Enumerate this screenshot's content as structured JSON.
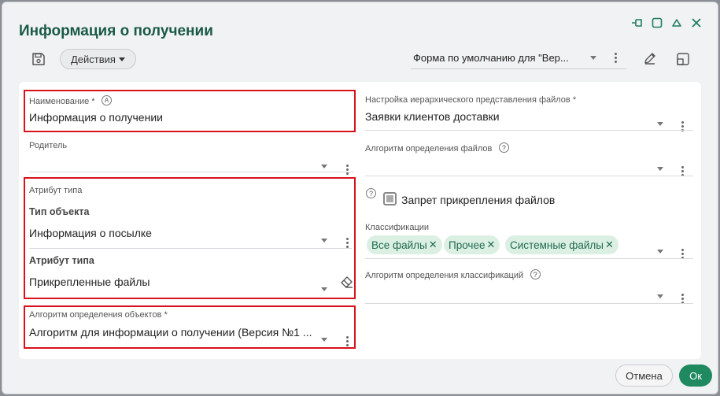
{
  "dialog": {
    "title": "Информация о получении"
  },
  "toolbar": {
    "actions_label": "Действия",
    "form_select": "Форма по умолчанию для \"Вер..."
  },
  "left": {
    "name_label": "Наименование *",
    "name_value": "Информация о получении",
    "parent_label": "Родитель",
    "type_attr_group_label": "Атрибут типа",
    "object_type_label": "Тип объекта",
    "object_type_value": "Информация о посылке",
    "type_attr_label": "Атрибут типа",
    "type_attr_value": "Прикрепленные файлы",
    "algo_objects_label": "Алгоритм определения объектов *",
    "algo_objects_value": "Алгоритм для информации о получении (Версия №1 ..."
  },
  "right": {
    "hierarchy_label": "Настройка иерархического представления файлов *",
    "hierarchy_value": "Заявки клиентов доставки",
    "algo_files_label": "Алгоритм определения файлов",
    "attach_ban_label": "Запрет прикрепления файлов",
    "classifications_label": "Классификации",
    "chips": [
      "Все файлы",
      "Прочее",
      "Системные файлы"
    ],
    "algo_class_label": "Алгоритм определения классификаций"
  },
  "footer": {
    "cancel_label": "Отмена",
    "ok_label": "Ок"
  },
  "colors": {
    "accent": "#1f8a60",
    "title": "#1a5a45",
    "highlight": "#d8121b",
    "chip_bg": "#dcefe3"
  },
  "icons": {
    "save": "save-icon",
    "edit": "pencil-icon",
    "expand": "expand-icon",
    "pin": "pin-icon",
    "maximize": "square-icon",
    "collapse": "chevron-up-icon",
    "close": "close-icon",
    "eraser": "eraser-icon"
  }
}
